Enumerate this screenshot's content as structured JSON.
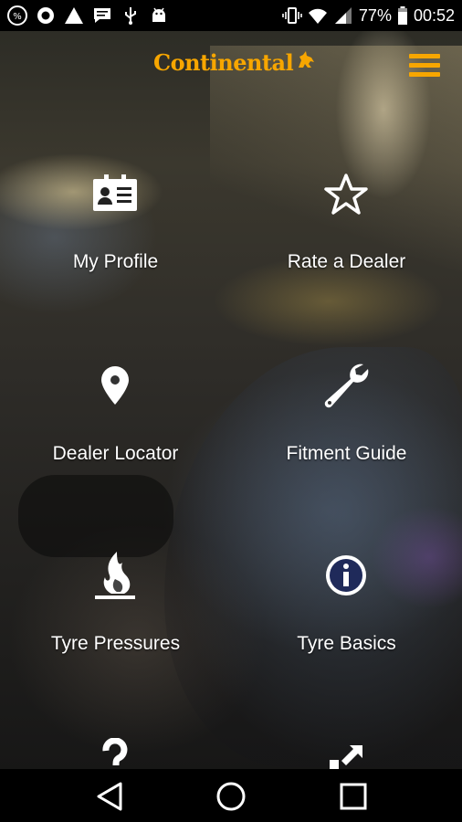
{
  "status_bar": {
    "battery_percent": "77%",
    "time": "00:52"
  },
  "header": {
    "logo_text": "Continental",
    "brand_color": "#f7a600",
    "menu_icon": "hamburger-menu-icon"
  },
  "tiles": [
    {
      "label": "My Profile",
      "icon": "id-card-icon"
    },
    {
      "label": "Rate a Dealer",
      "icon": "star-icon"
    },
    {
      "label": "Dealer Locator",
      "icon": "map-pin-icon"
    },
    {
      "label": "Fitment Guide",
      "icon": "wrench-icon"
    },
    {
      "label": "Tyre Pressures",
      "icon": "flame-icon"
    },
    {
      "label": "Tyre Basics",
      "icon": "info-icon"
    },
    {
      "label": "",
      "icon": "question-icon"
    },
    {
      "label": "",
      "icon": "share-arrow-icon"
    }
  ],
  "nav_bar": {
    "back": "back-triangle-icon",
    "home": "home-circle-icon",
    "recents": "recents-square-icon"
  }
}
